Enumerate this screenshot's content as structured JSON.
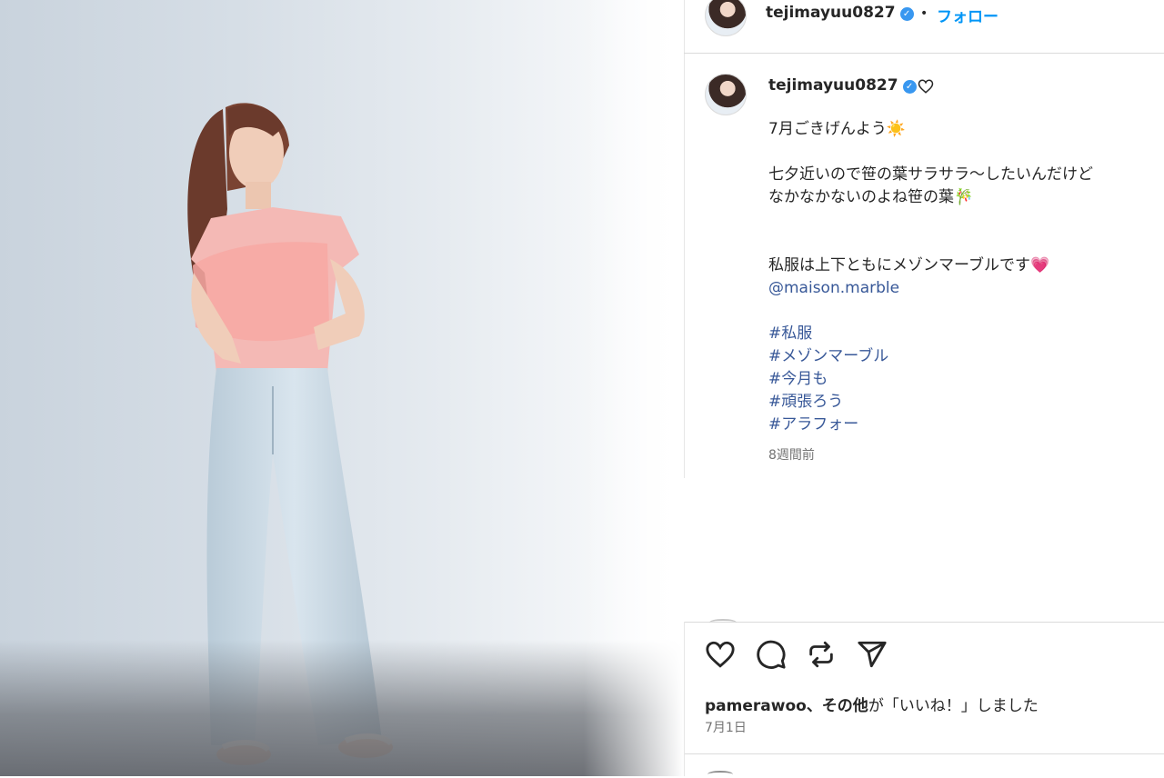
{
  "header": {
    "username": "tejimayuu0827",
    "separator": "•",
    "follow_label": "フォロー"
  },
  "caption": {
    "username": "tejimayuu0827",
    "lines": [
      "7月ごきげんよう☀️",
      "",
      "七夕近いので笹の葉サラサラ〜したいんだけど",
      "なかなかないのよね笹の葉🎋",
      "",
      "",
      "私服は上下ともにメゾンマーブルです💗"
    ],
    "mention": "@maison.marble",
    "hashtags": [
      "#私服",
      "#メゾンマーブル",
      "#今月も",
      "#頑張ろう",
      "#アラフォー"
    ],
    "time_ago": "8週間前"
  },
  "likes": {
    "user": "pamerawoo",
    "others": "、その他",
    "suffix": "が「いいね！」しました"
  },
  "date": "7月1日",
  "icons": [
    "verified-badge-icon",
    "heart-icon",
    "comment-icon",
    "repost-icon",
    "share-icon"
  ],
  "colors": {
    "follow": "#0095f6",
    "link": "#385898",
    "verified": "#3897f0",
    "muted": "#737373"
  }
}
